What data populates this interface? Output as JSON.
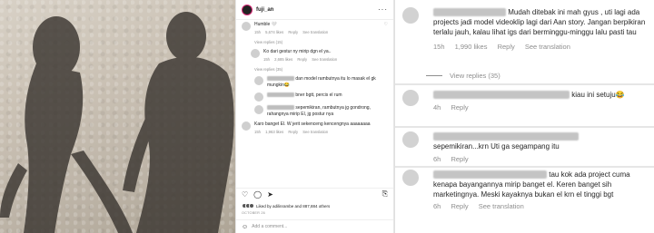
{
  "post": {
    "username": "fuji_an",
    "more_icon": "more-horizontal-icon",
    "comments": [
      {
        "text": "Humble 🤍",
        "time": "15h",
        "likes": "5,674 likes",
        "reply": "Reply",
        "translate": "See translation"
      },
      {
        "text": "Ko dari gestur ny mirip dgn el ya..",
        "time": "15h",
        "likes": "2,685 likes",
        "reply": "Reply",
        "translate": "See translation"
      },
      {
        "text": "dan model rambutnya itu lo masak el gk mungkin😂",
        "time": "",
        "likes": "",
        "reply": "",
        "translate": ""
      },
      {
        "text": "bner bgtt, percis el rum",
        "time": "",
        "likes": "",
        "reply": "",
        "translate": ""
      },
      {
        "text": "sepemikiran, rambutnya jg gondrong, rahangnya mirip El, jg postur nya",
        "time": "",
        "likes": "",
        "reply": "",
        "translate": ""
      },
      {
        "text": "Karo banget El. W jerit sekenceng kencengnya aaaaaaaa",
        "time": "15h",
        "likes": "1,963 likes",
        "reply": "Reply",
        "translate": "See translation"
      }
    ],
    "view_replies_1": "View replies (15)",
    "view_replies_2": "View replies (35)",
    "liked_by": "Liked by adilinrambe and 887,884 others",
    "date": "OCTOBER 26",
    "add_comment": "Add a comment..."
  },
  "zoom": {
    "c1": {
      "text": "Mudah ditebak ini mah gyus , uti lagi ada projects jadi model videoklip lagi dari Aan story. Jangan berpikiran terlalu jauh, kalau lihat igs dari berminggu-minggu lalu pasti tau",
      "time": "15h",
      "likes": "1,990 likes",
      "reply": "Reply",
      "translate": "See translation"
    },
    "view_replies": "View replies (35)",
    "c2": {
      "text": "kiau ini setuju😂",
      "time": "4h",
      "reply": "Reply"
    },
    "c3": {
      "text": "sepemikiran...krn Uti ga segampang itu",
      "time": "6h",
      "reply": "Reply"
    },
    "c4": {
      "text": "tau kok ada project cuma kenapa bayangannya mirip banget el. Keren banget sih marketingnya. Meski kayaknya bukan el krn el tinggi bgt",
      "time": "6h",
      "reply": "Reply",
      "translate": "See translation"
    }
  },
  "colors": {
    "muted": "#8e8e8e",
    "text": "#262626",
    "divider": "#e6e6e6"
  }
}
